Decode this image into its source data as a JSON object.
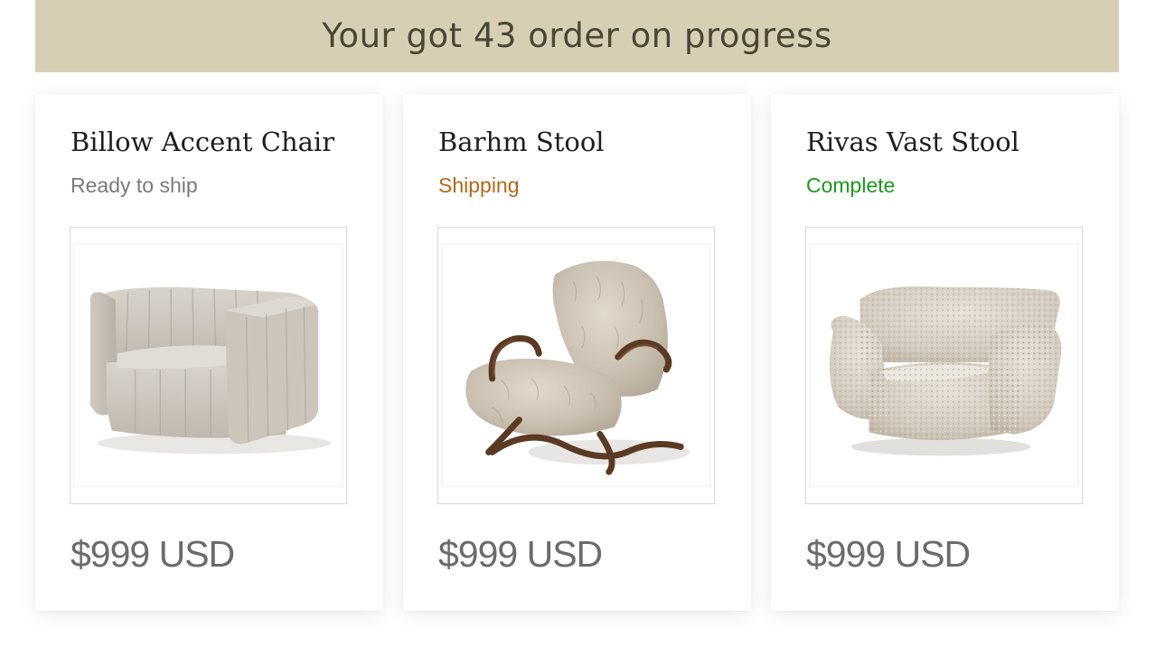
{
  "banner": {
    "text": "Your got 43 order on progress"
  },
  "orders": [
    {
      "title": "Billow Accent Chair",
      "status": "Ready to ship",
      "status_color": "#7a7a7a",
      "price": "$999 USD",
      "image": "channel-tufted-armchair-image"
    },
    {
      "title": "Barhm Stool",
      "status": "Shipping",
      "status_color": "#b3681a",
      "price": "$999 USD",
      "image": "fur-rocking-chair-image"
    },
    {
      "title": "Rivas Vast Stool",
      "status": "Complete",
      "status_color": "#1c9a1c",
      "price": "$999 USD",
      "image": "boucle-swivel-chair-image"
    }
  ],
  "colors": {
    "banner_bg": "#d6cfb4",
    "banner_text": "#4a4636"
  }
}
